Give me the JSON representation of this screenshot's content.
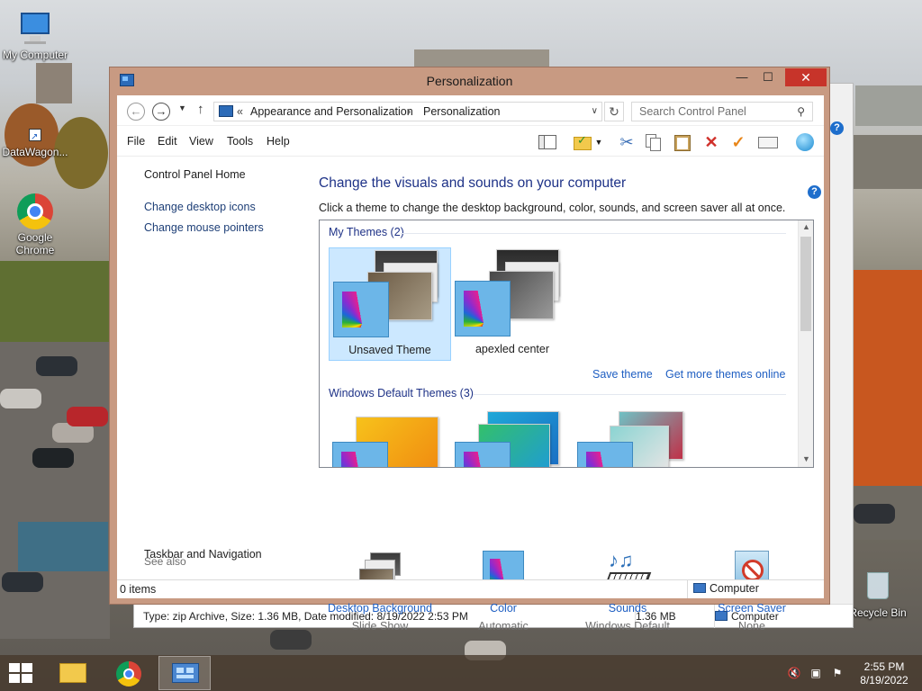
{
  "desktop": {
    "icons": [
      {
        "label": "My Computer"
      },
      {
        "label": "DataWagon..."
      },
      {
        "label": "Google Chrome"
      },
      {
        "label": "Recycle Bin"
      }
    ]
  },
  "back_window": {
    "status_text": "Type: zip Archive, Size: 1.36 MB, Date modified: 8/19/2022 2:53 PM",
    "status_size": "1.36 MB",
    "status_location": "Computer"
  },
  "window": {
    "title": "Personalization",
    "controls": {
      "minimize": "—",
      "maximize": "☐",
      "close": "✕"
    }
  },
  "address_bar": {
    "prefix": "«",
    "segments": [
      "Appearance and Personalization",
      "Personalization"
    ],
    "separator": "›",
    "search_placeholder": "Search Control Panel"
  },
  "menu": [
    "File",
    "Edit",
    "View",
    "Tools",
    "Help"
  ],
  "left_pane": {
    "home_link": "Control Panel Home",
    "links": [
      "Change desktop icons",
      "Change mouse pointers"
    ],
    "see_also_label": "See also",
    "see_also_links": [
      "Taskbar and Navigation"
    ]
  },
  "main": {
    "heading": "Change the visuals and sounds on your computer",
    "description": "Click a theme to change the desktop background, color, sounds, and screen saver all at once.",
    "my_themes": {
      "header": "My Themes (2)",
      "themes": [
        {
          "name": "Unsaved Theme",
          "selected": true
        },
        {
          "name": "apexled center",
          "selected": false
        }
      ]
    },
    "save_theme_link": "Save theme",
    "more_themes_link": "Get more themes online",
    "default_themes": {
      "header": "Windows Default Themes (3)"
    }
  },
  "settings": [
    {
      "label": "Desktop Background",
      "value": "Slide Show",
      "icon": "desktop-background-icon"
    },
    {
      "label": "Color",
      "value": "Automatic",
      "icon": "color-palette-icon"
    },
    {
      "label": "Sounds",
      "value": "Windows Default",
      "icon": "sounds-icon"
    },
    {
      "label": "Screen Saver",
      "value": "None",
      "icon": "screen-saver-icon"
    }
  ],
  "statusbar": {
    "items": "0 items",
    "location": "Computer"
  },
  "taskbar": {
    "time": "2:55 PM",
    "date": "8/19/2022"
  },
  "colors": {
    "window_frame": "#c89a82",
    "link": "#1e5ec2",
    "heading": "#1e3287",
    "selected_tile": "#cce8ff",
    "close_button": "#c7342a"
  }
}
